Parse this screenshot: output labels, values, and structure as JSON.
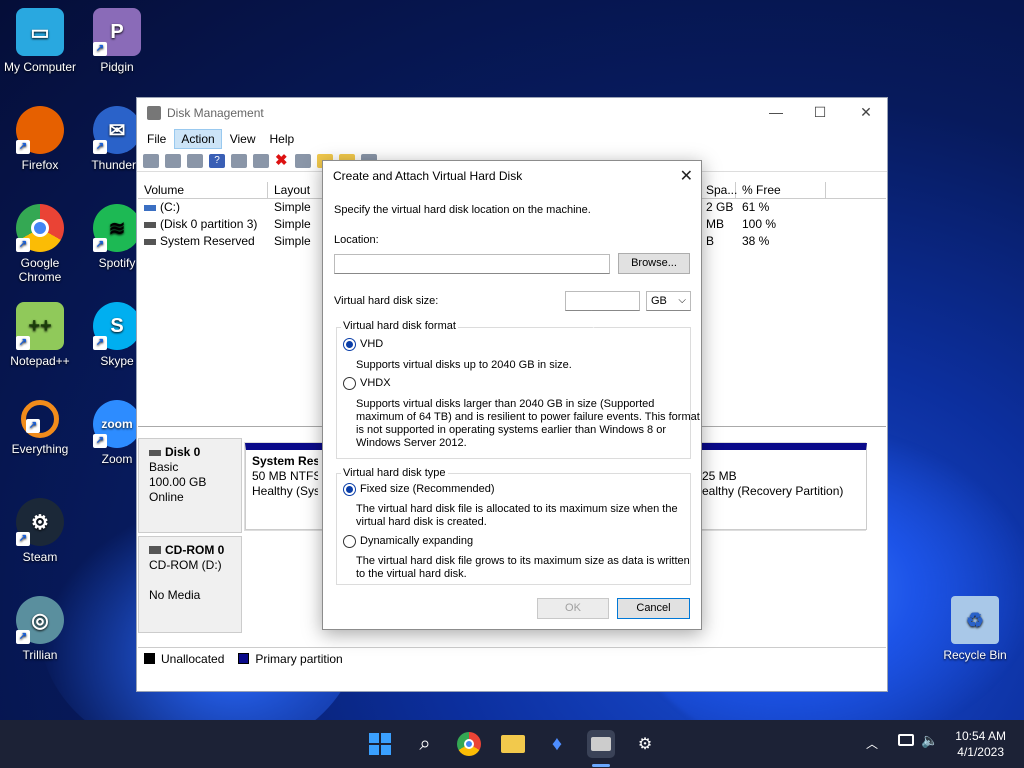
{
  "desktop_icons": [
    {
      "label": "My Computer",
      "icon": "computer-icon",
      "color": "#29a8e0"
    },
    {
      "label": "Pidgin",
      "icon": "pidgin-icon",
      "color": "#8a6bb8"
    },
    {
      "label": "Firefox",
      "icon": "firefox-icon",
      "color": "#e66000"
    },
    {
      "label": "Thunderb",
      "icon": "thunderbird-icon",
      "color": "#2a62c9"
    },
    {
      "label": "Google Chrome",
      "icon": "chrome-icon",
      "color": "#34a853"
    },
    {
      "label": "Spotify",
      "icon": "spotify-icon",
      "color": "#1db954"
    },
    {
      "label": "Notepad++",
      "icon": "notepad-plus-icon",
      "color": "#90c95a"
    },
    {
      "label": "Skype",
      "icon": "skype-icon",
      "color": "#00aff0"
    },
    {
      "label": "Everything",
      "icon": "everything-search-icon",
      "color": "#f28c1b"
    },
    {
      "label": "Zoom",
      "icon": "zoom-icon",
      "color": "#2d8cff"
    },
    {
      "label": "Steam",
      "icon": "steam-icon",
      "color": "#1b2838"
    },
    {
      "label": "Trillian",
      "icon": "trillian-icon",
      "color": "#5a8f9e"
    },
    {
      "label": "Recycle Bin",
      "icon": "recycle-bin-icon",
      "color": "#6fa8dc"
    }
  ],
  "window": {
    "title": "Disk Management",
    "menu": [
      "File",
      "Action",
      "View",
      "Help"
    ],
    "active_menu": "Action",
    "volume_headers": [
      "Volume",
      "Layout",
      "Spa...",
      "% Free"
    ],
    "volumes": [
      {
        "name": "(C:)",
        "layout": "Simple",
        "space": "2 GB",
        "free": "61 %"
      },
      {
        "name": "(Disk 0 partition 3)",
        "layout": "Simple",
        "space": "MB",
        "free": "100 %"
      },
      {
        "name": "System Reserved",
        "layout": "Simple",
        "space": "B",
        "free": "38 %"
      }
    ],
    "disk0": {
      "name": "Disk 0",
      "type": "Basic",
      "size": "100.00 GB",
      "status": "Online"
    },
    "disk0_partition1": {
      "name": "System Reser",
      "size": "50 MB NTFS",
      "status": "Healthy (Syste"
    },
    "disk0_partition3": {
      "size": "25 MB",
      "status": "ealthy (Recovery Partition)"
    },
    "cdrom": {
      "name": "CD-ROM 0",
      "drive": "CD-ROM (D:)",
      "status": "No Media"
    },
    "legend": [
      "Unallocated",
      "Primary partition"
    ]
  },
  "dialog": {
    "title": "Create and Attach Virtual Hard Disk",
    "intro": "Specify the virtual hard disk location on the machine.",
    "location_label": "Location:",
    "location_value": "",
    "browse_label": "Browse...",
    "size_label": "Virtual hard disk size:",
    "size_value": "",
    "size_unit": "GB",
    "format_group": "Virtual hard disk format",
    "vhd_label": "VHD",
    "vhd_desc": "Supports virtual disks up to 2040 GB in size.",
    "vhdx_label": "VHDX",
    "vhdx_desc_1": "Supports virtual disks larger than 2040 GB in size (Supported",
    "vhdx_desc_2": "maximum of 64 TB) and is resilient to power failure events. This format",
    "vhdx_desc_3": "is not supported in operating systems earlier than Windows 8 or",
    "vhdx_desc_4": "Windows Server 2012.",
    "type_group": "Virtual hard disk type",
    "fixed_label": "Fixed size (Recommended)",
    "fixed_desc_1": "The virtual hard disk file is allocated to its maximum size when the",
    "fixed_desc_2": "virtual hard disk is created.",
    "dynamic_label": "Dynamically expanding",
    "dynamic_desc_1": "The virtual hard disk file grows to its maximum size as data is written",
    "dynamic_desc_2": "to the virtual hard disk.",
    "ok_label": "OK",
    "cancel_label": "Cancel"
  },
  "taskbar": {
    "time": "10:54 AM",
    "date": "4/1/2023"
  }
}
